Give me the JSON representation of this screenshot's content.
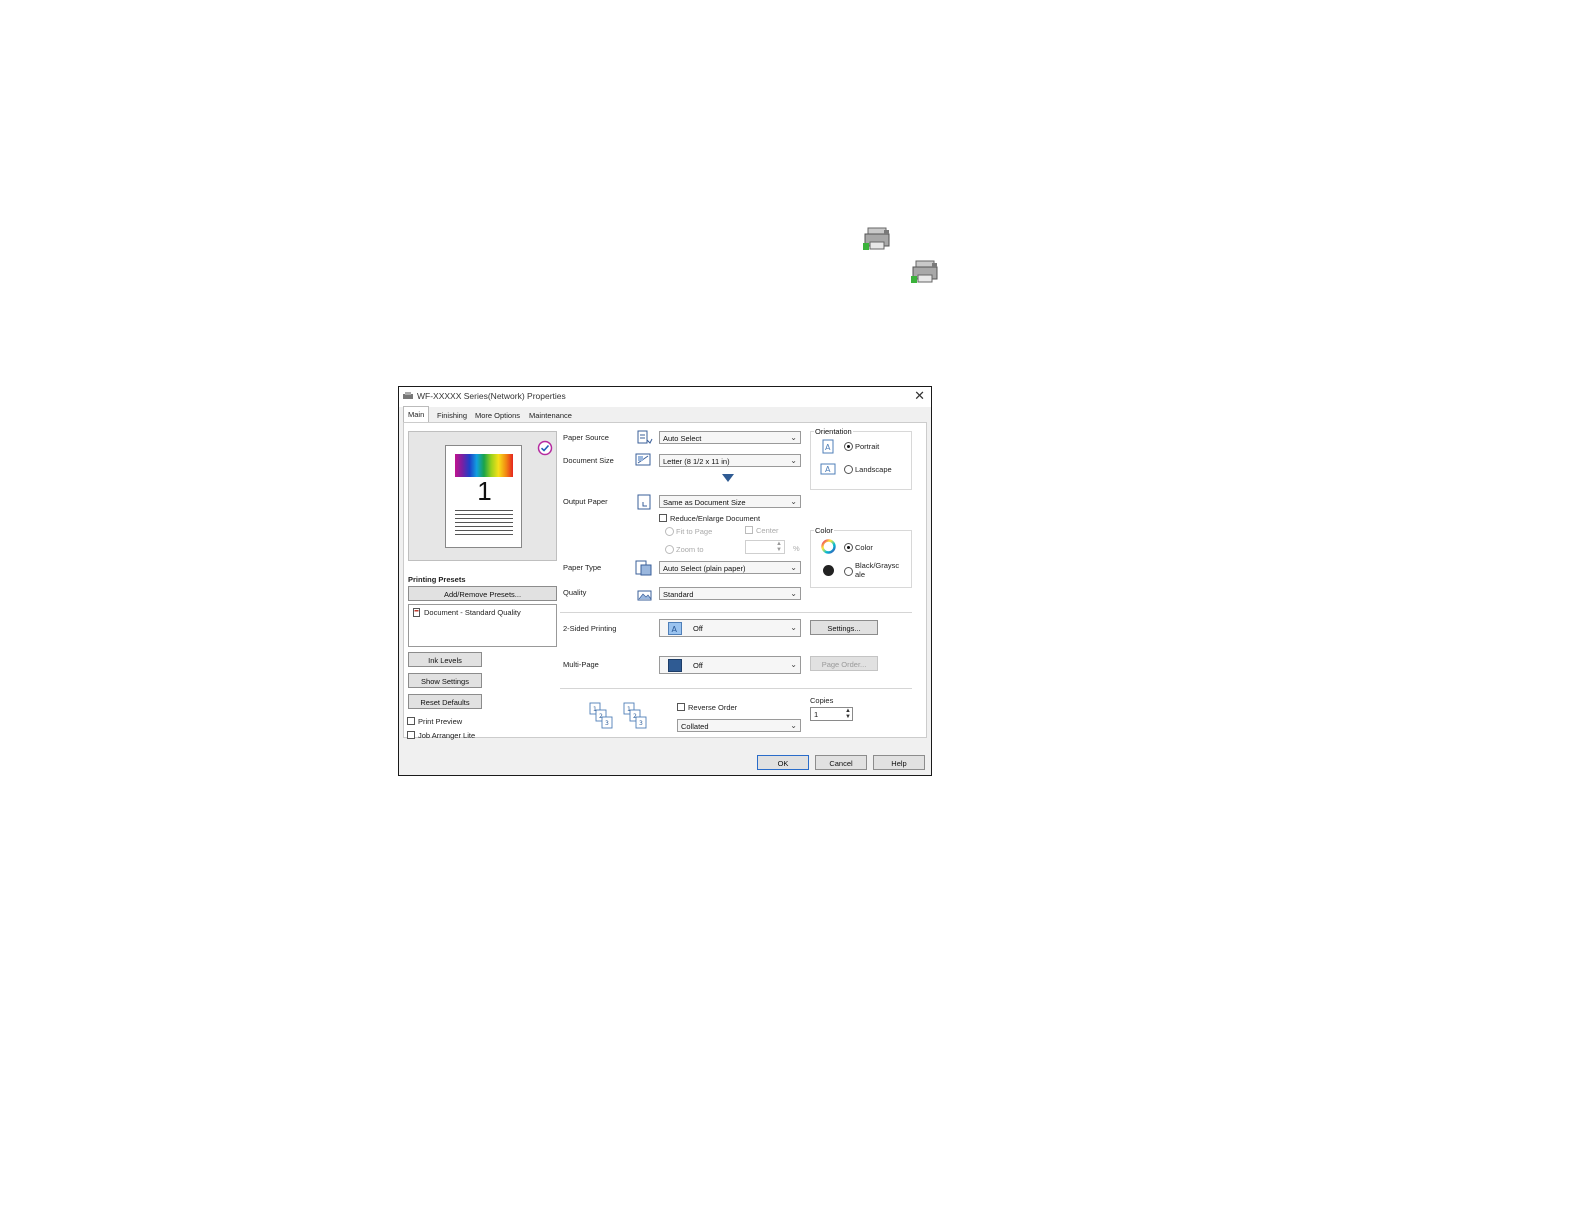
{
  "window": {
    "title": "WF-XXXXX Series(Network) Properties",
    "close_glyph": "✕",
    "tabs": [
      {
        "label": "Main"
      },
      {
        "label": "Finishing"
      },
      {
        "label": "More Options"
      },
      {
        "label": "Maintenance"
      }
    ]
  },
  "preview": {
    "page_number": "1"
  },
  "presets": {
    "heading": "Printing Presets",
    "add_remove_label": "Add/Remove Presets...",
    "items": [
      {
        "label": "Document - Standard Quality"
      }
    ]
  },
  "left_buttons": {
    "ink_levels": "Ink Levels",
    "show_settings": "Show Settings",
    "reset_defaults": "Reset Defaults"
  },
  "left_checkboxes": {
    "print_preview": "Print Preview",
    "job_arranger": "Job Arranger Lite"
  },
  "paper_source": {
    "label": "Paper Source",
    "value": "Auto Select"
  },
  "document_size": {
    "label": "Document Size",
    "value": "Letter (8 1/2 x 11 in)"
  },
  "output_paper": {
    "label": "Output Paper",
    "value": "Same as Document Size"
  },
  "reduce_enlarge": {
    "label": "Reduce/Enlarge Document",
    "fit_to_page": "Fit to Page",
    "center": "Center",
    "zoom_to": "Zoom to",
    "percent": "%"
  },
  "paper_type": {
    "label": "Paper Type",
    "value": "Auto Select (plain paper)"
  },
  "quality": {
    "label": "Quality",
    "value": "Standard"
  },
  "orientation": {
    "title": "Orientation",
    "portrait": "Portrait",
    "landscape": "Landscape",
    "selected": "Portrait"
  },
  "color": {
    "title": "Color",
    "color_label": "Color",
    "bw_label": "Black/Grayscale",
    "bw_label_line1": "Black/Graysc",
    "bw_label_line2": "ale",
    "selected": "Color"
  },
  "two_sided": {
    "label": "2-Sided Printing",
    "value": "Off",
    "settings_label": "Settings..."
  },
  "multi_page": {
    "label": "Multi-Page",
    "value": "Off",
    "page_order_label": "Page Order..."
  },
  "collation": {
    "reverse_order_label": "Reverse Order",
    "value": "Collated"
  },
  "copies": {
    "label": "Copies",
    "value": "1"
  },
  "footer": {
    "ok": "OK",
    "cancel": "Cancel",
    "help": "Help"
  },
  "colors": {
    "accent": "#2a6cc9",
    "orientation_icon": "#4f7fb8"
  }
}
